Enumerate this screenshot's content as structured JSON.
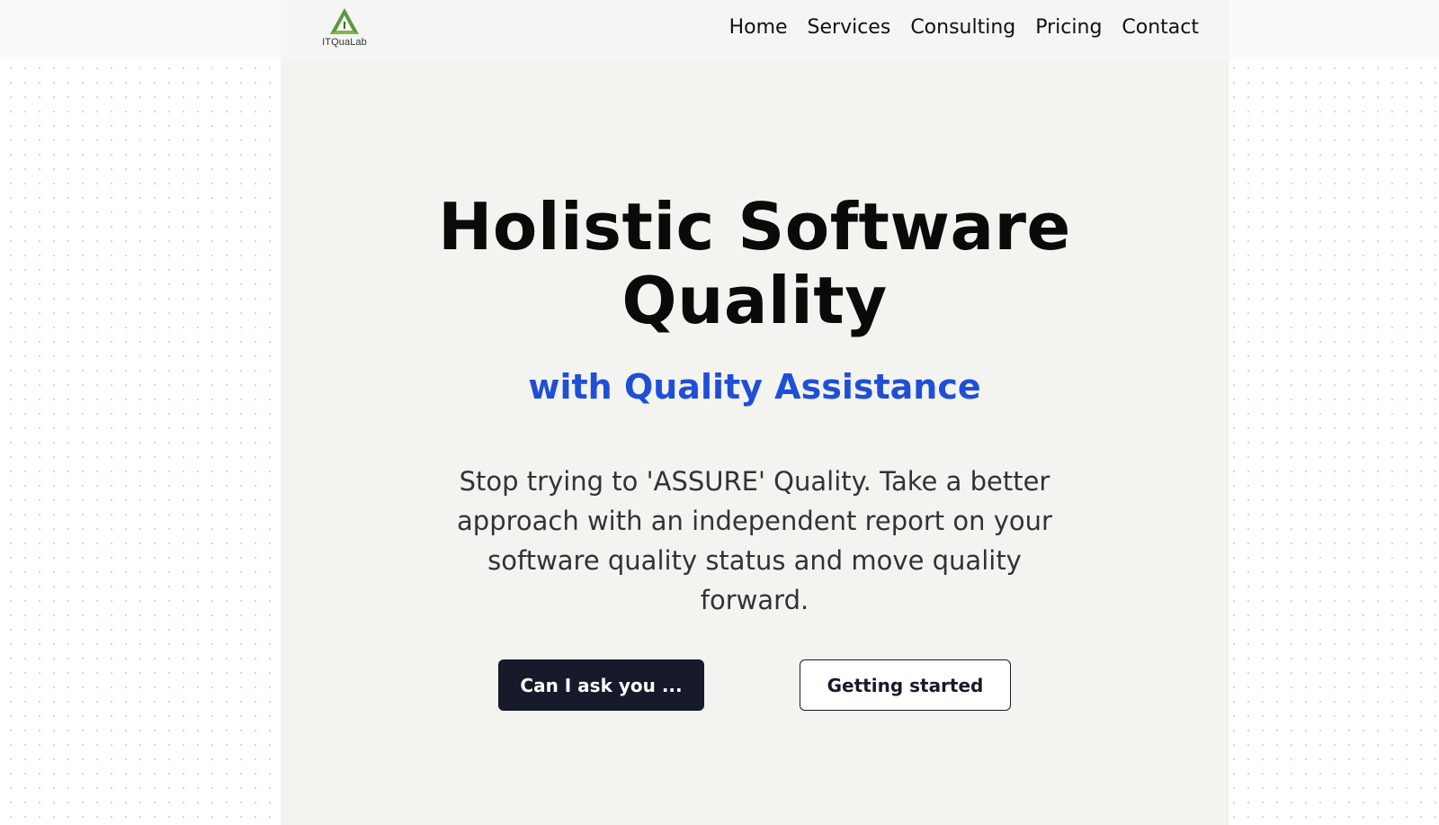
{
  "header": {
    "logo": {
      "text": "ITQuaLab",
      "icon": "triangle-logo-icon",
      "color": "#5a9a3a"
    },
    "nav": [
      {
        "label": "Home"
      },
      {
        "label": "Services"
      },
      {
        "label": "Consulting"
      },
      {
        "label": "Pricing"
      },
      {
        "label": "Contact"
      }
    ]
  },
  "hero": {
    "title_line1": "Holistic Software",
    "title_line2": "Quality",
    "subtitle": "with Quality Assistance",
    "description": "Stop trying to 'ASSURE' Quality. Take a better approach with an independent report on your software quality status and move quality forward.",
    "primary_button": "Can I ask you ...",
    "secondary_button": "Getting started"
  },
  "colors": {
    "accent": "#1f4fd6",
    "button_dark": "#161a2b",
    "panel_bg": "#f3f3ef",
    "logo_green": "#5a9a3a"
  }
}
